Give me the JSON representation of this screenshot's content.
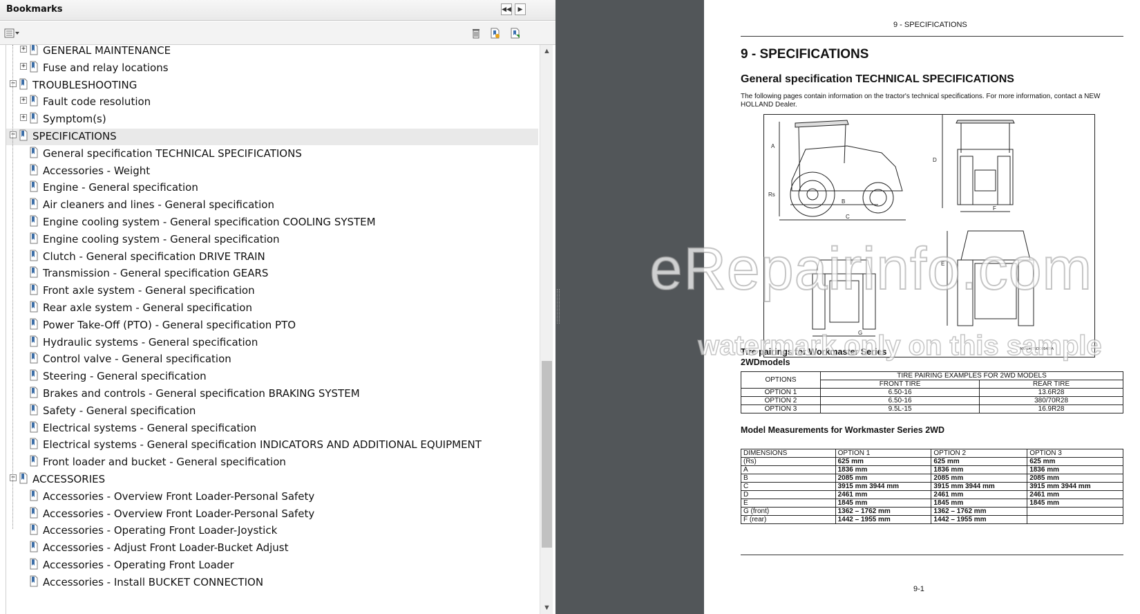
{
  "bookmarks_panel": {
    "title": "Bookmarks",
    "items": [
      {
        "label": "GENERAL MAINTENANCE",
        "level": 1,
        "expander": "+",
        "selected": false
      },
      {
        "label": "Fuse and relay locations",
        "level": 1,
        "expander": "+",
        "selected": false
      },
      {
        "label": "TROUBLESHOOTING",
        "level": 0,
        "expander": "-",
        "selected": false
      },
      {
        "label": "Fault code resolution",
        "level": 1,
        "expander": "+",
        "selected": false
      },
      {
        "label": "Symptom(s)",
        "level": 1,
        "expander": "+",
        "selected": false
      },
      {
        "label": "SPECIFICATIONS",
        "level": 0,
        "expander": "-",
        "selected": true
      },
      {
        "label": "General specification TECHNICAL SPECIFICATIONS",
        "level": 1,
        "expander": "",
        "selected": false
      },
      {
        "label": "Accessories - Weight",
        "level": 1,
        "expander": "",
        "selected": false
      },
      {
        "label": "Engine - General specification",
        "level": 1,
        "expander": "",
        "selected": false
      },
      {
        "label": "Air cleaners and lines - General specification",
        "level": 1,
        "expander": "",
        "selected": false
      },
      {
        "label": "Engine cooling system - General specification COOLING SYSTEM",
        "level": 1,
        "expander": "",
        "selected": false
      },
      {
        "label": "Engine cooling system - General specification",
        "level": 1,
        "expander": "",
        "selected": false
      },
      {
        "label": "Clutch - General specification DRIVE TRAIN",
        "level": 1,
        "expander": "",
        "selected": false
      },
      {
        "label": "Transmission - General specification GEARS",
        "level": 1,
        "expander": "",
        "selected": false
      },
      {
        "label": "Front axle system - General specification",
        "level": 1,
        "expander": "",
        "selected": false
      },
      {
        "label": "Rear axle system - General specification",
        "level": 1,
        "expander": "",
        "selected": false
      },
      {
        "label": "Power Take-Off (PTO) - General specification PTO",
        "level": 1,
        "expander": "",
        "selected": false
      },
      {
        "label": "Hydraulic systems - General specification",
        "level": 1,
        "expander": "",
        "selected": false
      },
      {
        "label": "Control valve - General specification",
        "level": 1,
        "expander": "",
        "selected": false
      },
      {
        "label": "Steering - General specification",
        "level": 1,
        "expander": "",
        "selected": false
      },
      {
        "label": "Brakes and controls - General specification BRAKING SYSTEM",
        "level": 1,
        "expander": "",
        "selected": false
      },
      {
        "label": "Safety - General specification",
        "level": 1,
        "expander": "",
        "selected": false
      },
      {
        "label": "Electrical systems - General specification",
        "level": 1,
        "expander": "",
        "selected": false
      },
      {
        "label": "Electrical systems - General specification INDICATORS AND ADDITIONAL EQUIPMENT",
        "level": 1,
        "expander": "",
        "selected": false
      },
      {
        "label": "Front loader and bucket - General specification",
        "level": 1,
        "expander": "",
        "selected": false
      },
      {
        "label": "ACCESSORIES",
        "level": 0,
        "expander": "-",
        "selected": false
      },
      {
        "label": "Accessories - Overview Front Loader-Personal Safety",
        "level": 1,
        "expander": "",
        "selected": false
      },
      {
        "label": "Accessories - Overview Front Loader-Personal Safety",
        "level": 1,
        "expander": "",
        "selected": false
      },
      {
        "label": "Accessories - Operating Front Loader-Joystick",
        "level": 1,
        "expander": "",
        "selected": false
      },
      {
        "label": "Accessories - Adjust Front Loader-Bucket Adjust",
        "level": 1,
        "expander": "",
        "selected": false
      },
      {
        "label": "Accessories - Operating Front Loader",
        "level": 1,
        "expander": "",
        "selected": false
      },
      {
        "label": "Accessories - Install BUCKET CONNECTION",
        "level": 1,
        "expander": "",
        "selected": false
      }
    ]
  },
  "document": {
    "running_head": "9 - SPECIFICATIONS",
    "chapter_title": "9 - SPECIFICATIONS",
    "section_title": "General specification TECHNICAL SPECIFICATIONS",
    "intro": "The following pages contain information on the tractor's technical specifications.  For more information, contact a NEW HOLLAND Dealer.",
    "figure": {
      "labels": [
        "A",
        "Rs",
        "B",
        "C",
        "D",
        "F",
        "E",
        "G"
      ],
      "code": "ANAL4775DO0547FA"
    },
    "tire_caption": "Tire    pairings    for    Workmaster    Series 2WDmodels",
    "tire_table": {
      "options_header": "OPTIONS",
      "group_header": "TIRE PAIRING EXAMPLES FOR 2WD MODELS",
      "front_header": "FRONT TIRE",
      "rear_header": "REAR TIRE",
      "rows": [
        [
          "OPTION 1",
          "6.50-16",
          "13.6R28"
        ],
        [
          "OPTION 2",
          "6.50-16",
          "380/70R28"
        ],
        [
          "OPTION 3",
          "9.5L-15",
          "16.9R28"
        ]
      ]
    },
    "measure_caption": "Model Measurements for Workmaster Series 2WD",
    "measure_table": {
      "headers": [
        "DIMENSIONS",
        "OPTION 1",
        "OPTION 2",
        "OPTION 3"
      ],
      "rows": [
        [
          "(Rs)",
          "625 mm",
          "625 mm",
          "625 mm"
        ],
        [
          "A",
          "1836 mm",
          "1836 mm",
          "1836 mm"
        ],
        [
          "B",
          "2085 mm",
          "2085 mm",
          "2085 mm"
        ],
        [
          "C",
          "3915 mm 3944 mm",
          "3915 mm 3944 mm",
          "3915 mm 3944 mm"
        ],
        [
          "D",
          "2461 mm",
          "2461 mm",
          "2461 mm"
        ],
        [
          "E",
          "1845 mm",
          "1845 mm",
          "1845 mm"
        ],
        [
          "G (front)",
          "1362 – 1762 mm",
          "1362 – 1762 mm",
          ""
        ],
        [
          "F (rear)",
          "1442 – 1955 mm",
          "1442 – 1955 mm",
          ""
        ]
      ]
    },
    "page_number": "9-1"
  },
  "watermark": {
    "line1": "eRepairinfo.com",
    "line2": "watermark only on this sample"
  },
  "colors": {
    "gutter": "#525659",
    "selected_row": "#e9e9e9",
    "scroll_thumb": "#c1c1c1"
  },
  "icons": {
    "collapse": "double-chevron-left-icon",
    "options": "bookmark-options-icon",
    "delete": "trash-icon",
    "new_bookmark": "new-bookmark-icon",
    "expand_bookmark": "expand-bookmark-icon"
  }
}
